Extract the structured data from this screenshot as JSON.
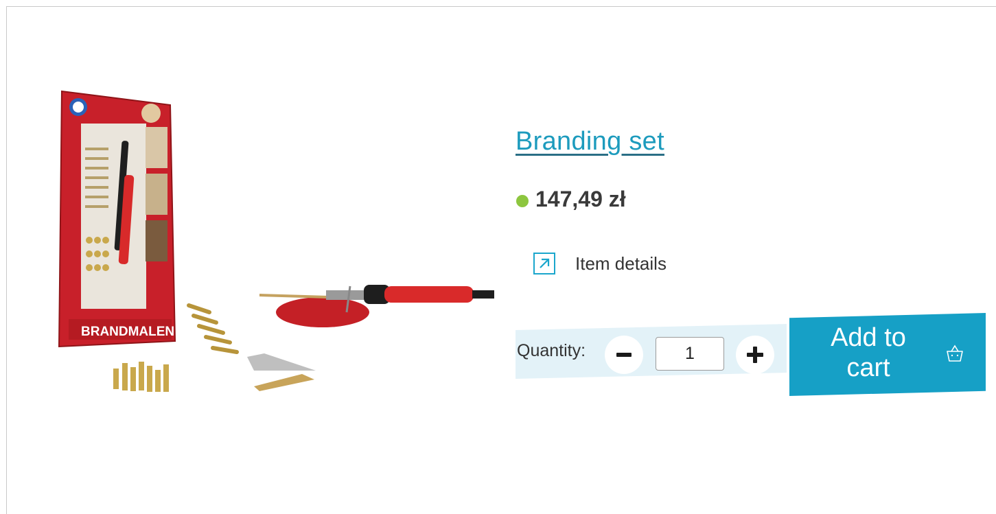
{
  "product": {
    "title": "Branding set",
    "price": "147,49 zł",
    "availability_color": "#8dc63f",
    "details_label": "Item details",
    "image_box_text": "BRANDMALEN"
  },
  "quantity": {
    "label": "Quantity:",
    "value": "1"
  },
  "cart": {
    "button_label": "Add to cart"
  },
  "colors": {
    "accent": "#16a0c6",
    "title_link": "#1d9bbd",
    "quantity_panel": "#e3f2f8"
  },
  "icons": {
    "details": "arrow-up-right-icon",
    "cart": "basket-icon",
    "minus": "minus-icon",
    "plus": "plus-icon"
  }
}
